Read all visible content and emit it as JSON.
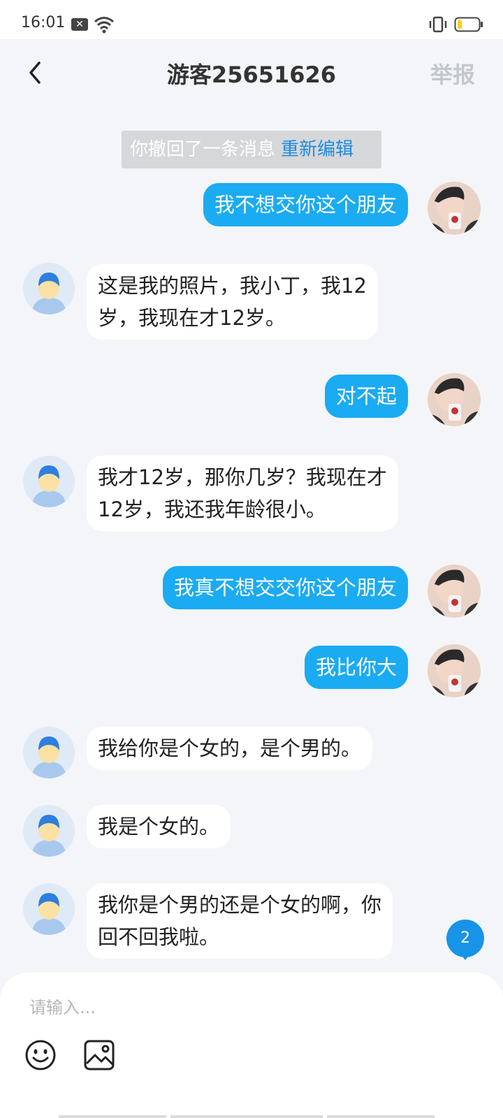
{
  "status_bar": {
    "time": "16:01",
    "icons": [
      "notification-icon",
      "wifi-icon",
      "vibrate-icon",
      "battery-icon"
    ]
  },
  "header": {
    "title": "游客25651626",
    "report_label": "举报",
    "back_icon": "chevron-left-icon"
  },
  "recall_notice": {
    "text": "你撤回了一条消息",
    "edit_label": "重新编辑"
  },
  "messages": [
    {
      "from": "me",
      "text": "我不想交你这个朋友"
    },
    {
      "from": "other",
      "text": "这是我的照片，我小丁，我12\n岁，我现在才12岁。"
    },
    {
      "from": "me",
      "text": "对不起"
    },
    {
      "from": "other",
      "text": "我才12岁，那你几岁？我现在才\n12岁，我还我年龄很小。"
    },
    {
      "from": "me",
      "text": "我真不想交交你这个朋友"
    },
    {
      "from": "me",
      "text": "我比你大"
    },
    {
      "from": "other",
      "text": "我给你是个女的，是个男的。"
    },
    {
      "from": "other",
      "text": "我是个女的。"
    },
    {
      "from": "other",
      "text": "我你是个男的还是个女的啊，你\n回不回我啦。"
    }
  ],
  "unread_badge": "2",
  "input": {
    "placeholder": "请输入..."
  },
  "toolbar_icons": [
    "emoji-icon",
    "image-icon"
  ],
  "colors": {
    "outgoing_bubble": "#1aabf2",
    "incoming_bubble": "#ffffff",
    "accent": "#1d8ce0",
    "background": "#f3f5f8"
  }
}
